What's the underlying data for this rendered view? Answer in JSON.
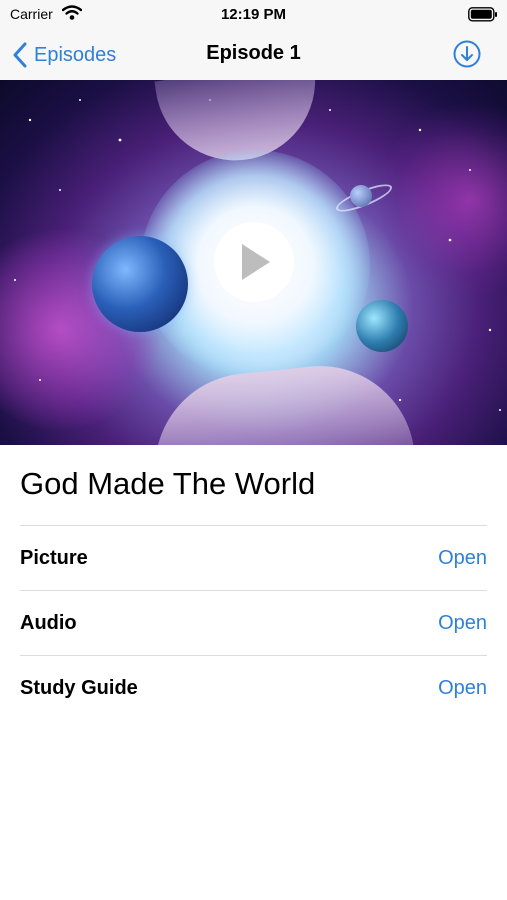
{
  "status_bar": {
    "carrier": "Carrier",
    "time": "12:19 PM",
    "icons": [
      "wifi-icon",
      "battery-icon"
    ]
  },
  "nav_bar": {
    "back_label": "Episodes",
    "title": "Episode 1",
    "icons": [
      "back-chevron-icon",
      "download-icon"
    ],
    "accent_color": "#2f80d8"
  },
  "media": {
    "play_icon": "play-icon"
  },
  "episode": {
    "title": "God Made The World"
  },
  "rows": [
    {
      "label": "Picture",
      "action": "Open"
    },
    {
      "label": "Audio",
      "action": "Open"
    },
    {
      "label": "Study Guide",
      "action": "Open"
    }
  ]
}
